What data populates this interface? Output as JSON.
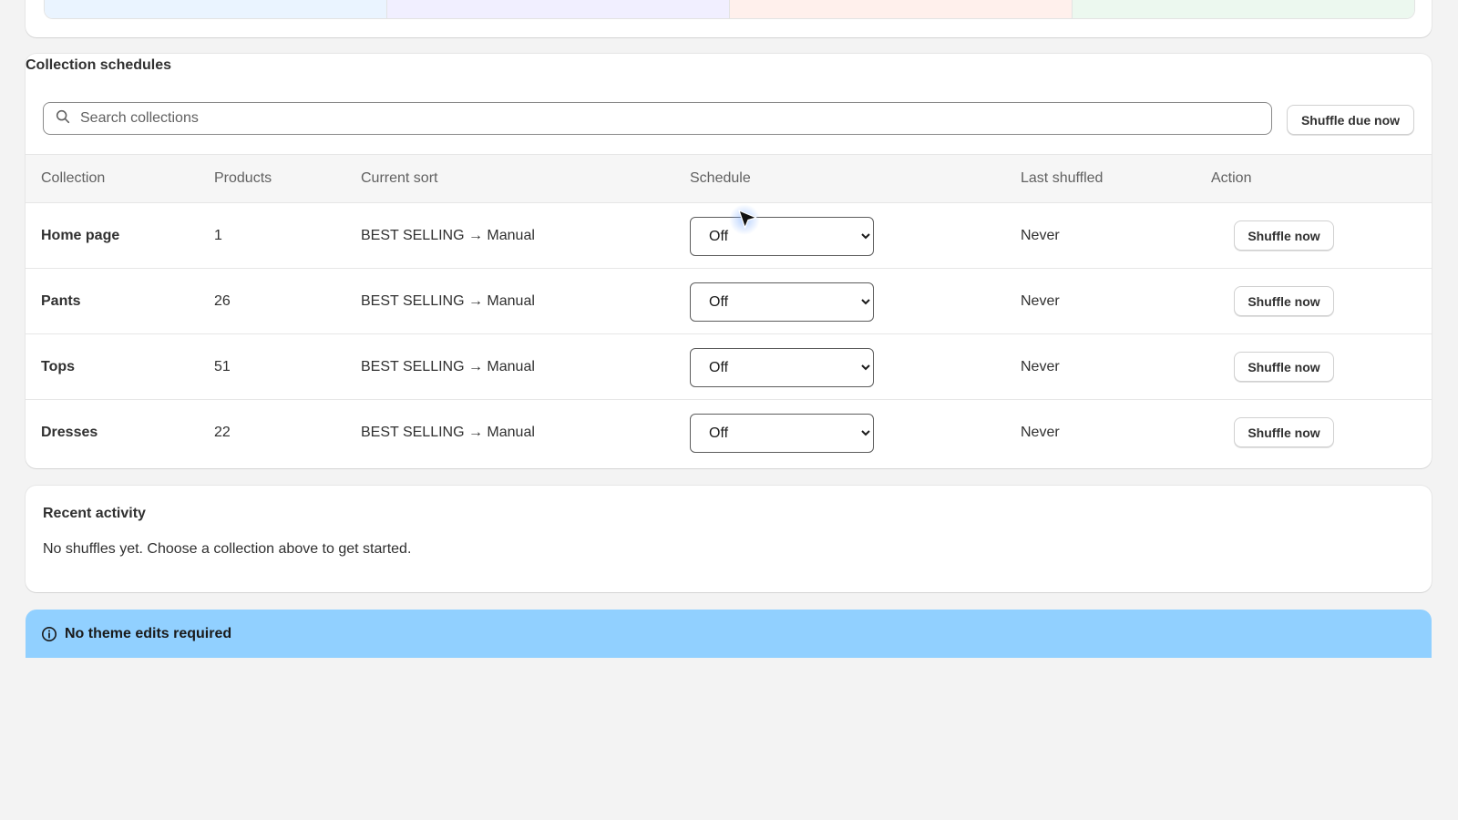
{
  "stats_strip": {
    "tile_colors": [
      "#eaf4ff",
      "#f1efff",
      "#fff0ec",
      "#ecf8ef"
    ]
  },
  "collections": {
    "title": "Collection schedules",
    "search_placeholder": "Search collections",
    "shuffle_due_label": "Shuffle due now",
    "columns": {
      "collection": "Collection",
      "products": "Products",
      "current_sort": "Current sort",
      "schedule": "Schedule",
      "last_shuffled": "Last shuffled",
      "action": "Action"
    },
    "rows": [
      {
        "name": "Home page",
        "products": "1",
        "sort": "BEST SELLING → Manual",
        "schedule": "Off",
        "last": "Never",
        "action": "Shuffle now"
      },
      {
        "name": "Pants",
        "products": "26",
        "sort": "BEST SELLING → Manual",
        "schedule": "Off",
        "last": "Never",
        "action": "Shuffle now"
      },
      {
        "name": "Tops",
        "products": "51",
        "sort": "BEST SELLING → Manual",
        "schedule": "Off",
        "last": "Never",
        "action": "Shuffle now"
      },
      {
        "name": "Dresses",
        "products": "22",
        "sort": "BEST SELLING → Manual",
        "schedule": "Off",
        "last": "Never",
        "action": "Shuffle now"
      }
    ]
  },
  "activity": {
    "title": "Recent activity",
    "empty_text": "No shuffles yet. Choose a collection above to get started."
  },
  "banner": {
    "title": "No theme edits required",
    "icon": "info-icon",
    "color": "#91d0ff"
  }
}
